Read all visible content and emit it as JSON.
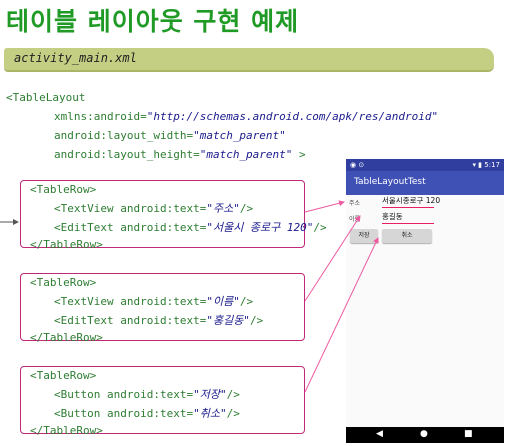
{
  "title": "테이블 레이아웃 구현 예제",
  "file_label": "activity_main.xml",
  "code": {
    "root_open": "<TableLayout",
    "xmlns_attr": "xmlns:android",
    "xmlns_val": "\"http://schemas.android.com/apk/res/android\"",
    "width_attr": "android:layout_width",
    "width_val": "\"match_parent\"",
    "height_attr": "android:layout_height",
    "height_val": "\"match_parent\"",
    "close_bracket": " >",
    "row_open": "<TableRow>",
    "row_close": "</TableRow>",
    "row1_l1_pre": "<TextView android:text=",
    "row1_l1_val": "\"주소\"",
    "row1_l1_post": "/>",
    "row1_l2_pre": "<EditText android:text=",
    "row1_l2_val": "\"서울시 종로구 120\"",
    "row1_l2_post": "/>",
    "row2_l1_pre": "<TextView android:text=",
    "row2_l1_val": "\"이름\"",
    "row2_l1_post": "/>",
    "row2_l2_pre": "<EditText android:text=",
    "row2_l2_val": "\"홍길동\"",
    "row2_l2_post": "/>",
    "row3_l1_pre": "<Button android:text=",
    "row3_l1_val": "\"저장\"",
    "row3_l1_post": "/>",
    "row3_l2_pre": "<Button android:text=",
    "row3_l2_val": "\"취소\"",
    "row3_l2_post": "/>"
  },
  "phone": {
    "status_time": "5:17",
    "app_title": "TableLayoutTest",
    "address_label": "주소",
    "address_value": "서울시종로구 120",
    "name_label": "이름",
    "name_value": "홍길동",
    "save_button": "저장",
    "cancel_button": "취소"
  },
  "colors": {
    "title": "#1f9a25",
    "box_border": "#c0287a",
    "arrow": "#ee5aa0",
    "appbar": "#3f51b5"
  }
}
